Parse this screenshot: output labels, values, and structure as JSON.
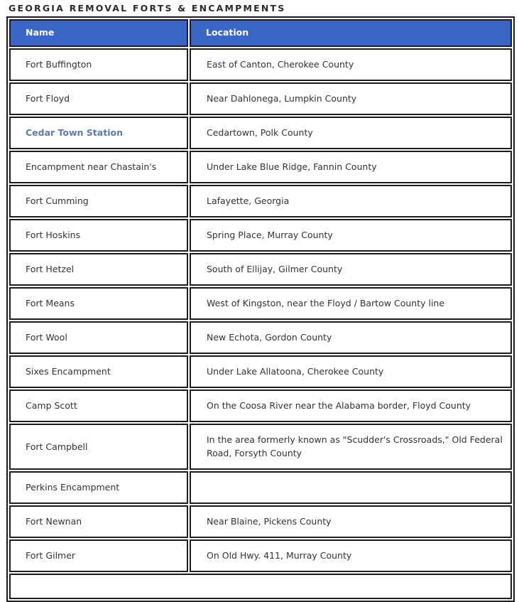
{
  "page": {
    "title": "GEORGIA REMOVAL FORTS & ENCAMPMENTS"
  },
  "colors": {
    "header_background": "#3A66C8",
    "header_text": "#FFFFFF",
    "header_border": "#1A1A3C",
    "cell_border": "#1C1C1C",
    "cell_text": "#333333",
    "link_text": "#5C7AAE",
    "page_background": "#FFFFFF"
  },
  "table": {
    "columns": [
      {
        "key": "name",
        "label": "Name"
      },
      {
        "key": "location",
        "label": "Location"
      }
    ],
    "rows": [
      {
        "name": "Fort Buffington",
        "location": "East of Canton, Cherokee County",
        "is_link": false
      },
      {
        "name": "Fort Floyd",
        "location": "Near Dahlonega, Lumpkin County",
        "is_link": false
      },
      {
        "name": "Cedar Town Station",
        "location": "Cedartown, Polk County",
        "is_link": true
      },
      {
        "name": "Encampment near Chastain's",
        "location": "Under Lake Blue Ridge, Fannin County",
        "is_link": false
      },
      {
        "name": "Fort Cumming",
        "location": "Lafayette, Georgia",
        "is_link": false
      },
      {
        "name": "Fort Hoskins",
        "location": "Spring Place, Murray County",
        "is_link": false
      },
      {
        "name": "Fort Hetzel",
        "location": "South of Ellijay, Gilmer County",
        "is_link": false
      },
      {
        "name": "Fort Means",
        "location": "West of Kingston, near the Floyd / Bartow County line",
        "is_link": false
      },
      {
        "name": "Fort Wool",
        "location": "New Echota, Gordon County",
        "is_link": false
      },
      {
        "name": "Sixes Encampment",
        "location": "Under Lake Allatoona, Cherokee County",
        "is_link": false
      },
      {
        "name": "Camp Scott",
        "location": "On the Coosa River near the Alabama border, Floyd County",
        "is_link": false
      },
      {
        "name": "Fort Campbell",
        "location": "In the area formerly known as \"Scudder's Crossroads,\" Old Federal Road, Forsyth County",
        "is_link": false
      },
      {
        "name": "Perkins Encampment",
        "location": "",
        "is_link": false
      },
      {
        "name": "Fort Newnan",
        "location": "Near Blaine, Pickens County",
        "is_link": false
      },
      {
        "name": "Fort Gilmer",
        "location": "On Old Hwy. 411, Murray County",
        "is_link": false
      }
    ],
    "footer_row": {
      "content": ""
    }
  }
}
